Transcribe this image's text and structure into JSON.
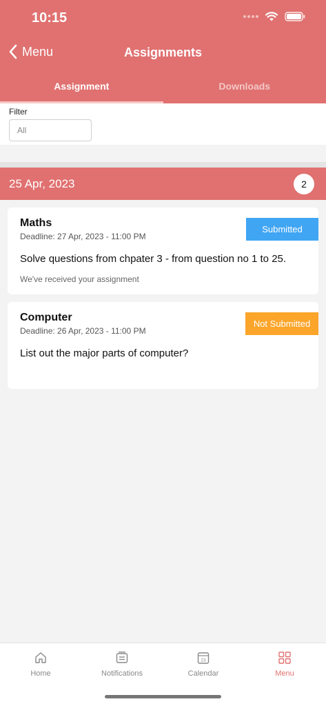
{
  "status_bar": {
    "time": "10:15"
  },
  "nav": {
    "back_label": "Menu",
    "title": "Assignments"
  },
  "tabs": [
    {
      "label": "Assignment",
      "active": true
    },
    {
      "label": "Downloads",
      "active": false
    }
  ],
  "filter": {
    "label": "Filter",
    "value": "All"
  },
  "section": {
    "date": "25 Apr, 2023",
    "count": "2"
  },
  "assignments": [
    {
      "subject": "Maths",
      "deadline": "Deadline: 27 Apr, 2023 - 11:00 PM",
      "description": "Solve questions from chpater 3 - from question no 1 to 25.",
      "note": "We've received your assignment",
      "status": "Submitted",
      "status_color": "#40a5f3"
    },
    {
      "subject": "Computer",
      "deadline": "Deadline: 26 Apr, 2023 - 11:00 PM",
      "description": "List out the major parts of computer?",
      "note": "",
      "status": "Not Submitted",
      "status_color": "#fba52b"
    }
  ],
  "bottom_nav": [
    {
      "label": "Home",
      "icon": "home-icon",
      "active": false
    },
    {
      "label": "Notifications",
      "icon": "notifications-icon",
      "active": false
    },
    {
      "label": "Calendar",
      "icon": "calendar-icon",
      "active": false,
      "icon_text": "23"
    },
    {
      "label": "Menu",
      "icon": "menu-grid-icon",
      "active": true
    }
  ],
  "colors": {
    "brand": "#e07170",
    "accent_active": "#e07170"
  }
}
